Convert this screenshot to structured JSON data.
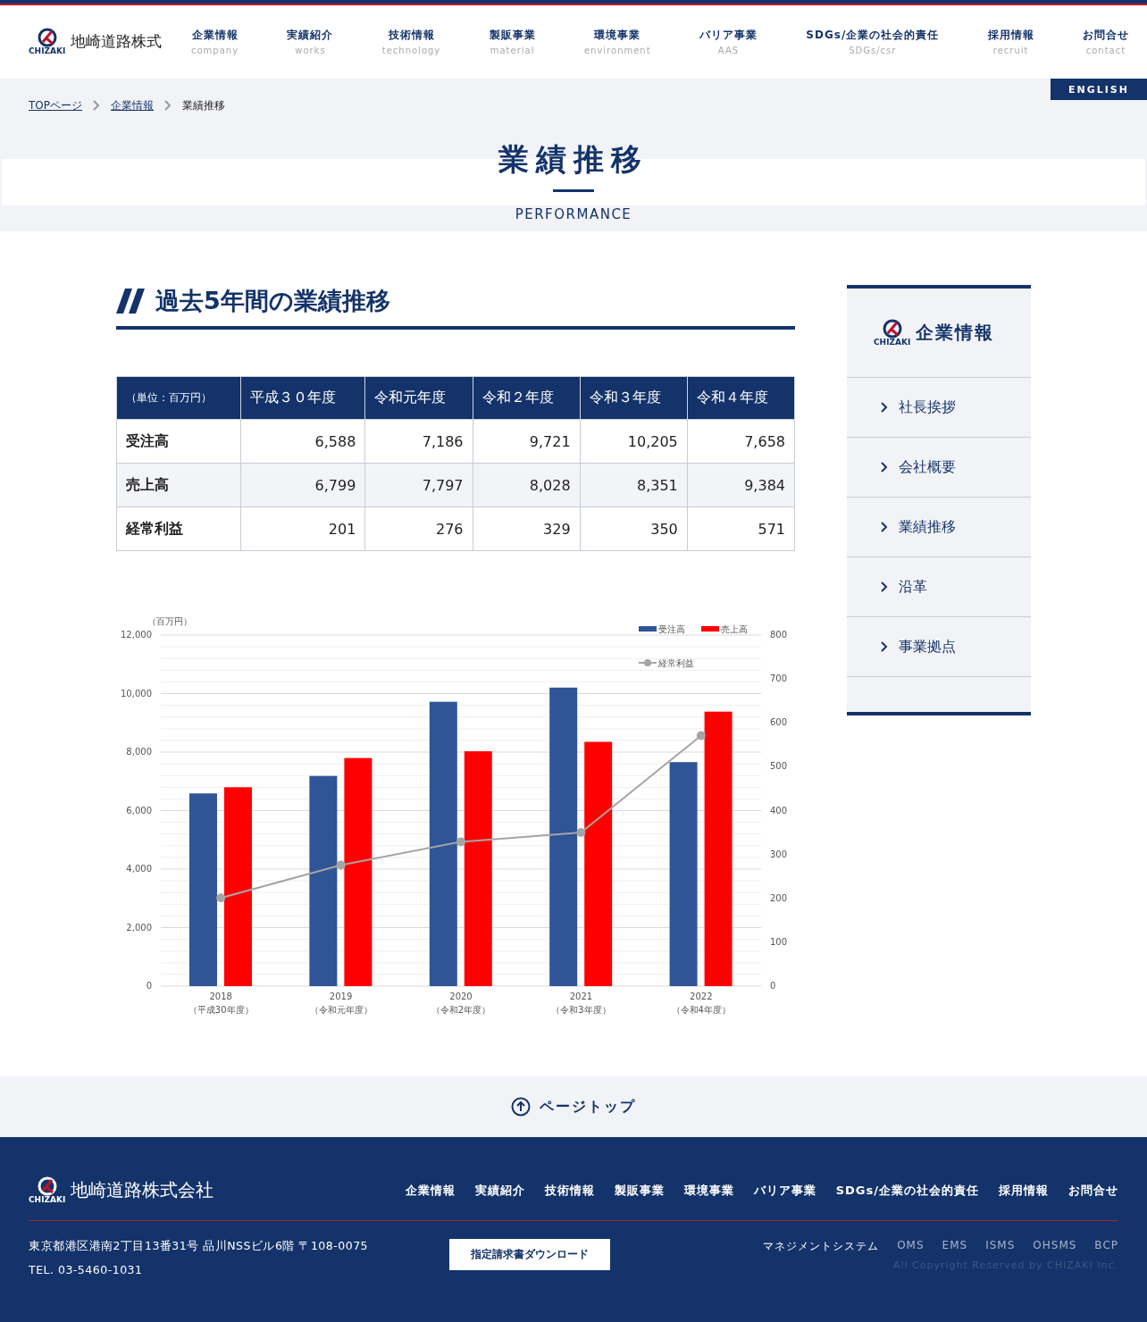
{
  "header": {
    "logo_mark": "CHIZAKI",
    "company": "地崎道路株式",
    "nav": [
      {
        "label": "企業情報",
        "sub": "company"
      },
      {
        "label": "実績紹介",
        "sub": "works"
      },
      {
        "label": "技術情報",
        "sub": "technology"
      },
      {
        "label": "製販事業",
        "sub": "material"
      },
      {
        "label": "環境事業",
        "sub": "environment"
      },
      {
        "label": "バリア事業",
        "sub": "AAS"
      },
      {
        "label": "SDGs/企業の社会的責任",
        "sub": "SDGs/csr"
      },
      {
        "label": "採用情報",
        "sub": "recruit"
      },
      {
        "label": "お問合せ",
        "sub": "contact"
      }
    ],
    "language_button": "ENGLISH"
  },
  "breadcrumb": [
    {
      "label": "TOPページ",
      "link": true
    },
    {
      "label": "企業情報",
      "link": true
    },
    {
      "label": "業績推移",
      "link": false
    }
  ],
  "page_title": "業績推移",
  "page_subtitle": "PERFORMANCE",
  "section_heading": "過去5年間の業績推移",
  "table": {
    "columns": [
      "（単位：百万円）",
      "平成３０年度",
      "令和元年度",
      "令和２年度",
      "令和３年度",
      "令和４年度"
    ],
    "rows": [
      [
        "受注高",
        "6,588",
        "7,186",
        "9,721",
        "10,205",
        "7,658"
      ],
      [
        "売上高",
        "6,799",
        "7,797",
        "8,028",
        "8,351",
        "9,384"
      ],
      [
        "経常利益",
        "201",
        "276",
        "329",
        "350",
        "571"
      ]
    ]
  },
  "chart": {
    "unit": "（百万円）",
    "category_notes": [
      "（平成30年度）",
      "（令和元年度）",
      "（令和2年度）",
      "（令和3年度）",
      "（令和4年度）"
    ],
    "chart_data": {
      "type": "bar",
      "categories": [
        "2018",
        "2019",
        "2020",
        "2021",
        "2022"
      ],
      "stacked": false,
      "grid": true,
      "legend": "upper right",
      "series": [
        {
          "name": "受注高",
          "color": "#2f5597",
          "values": [
            6588,
            7186,
            9721,
            10205,
            7658
          ]
        },
        {
          "name": "売上高",
          "color": "#ff0000",
          "values": [
            6799,
            7797,
            8028,
            8351,
            9384
          ]
        },
        {
          "name": "経常利益",
          "color": "#a5a5a5",
          "type": "line",
          "axis": "y2",
          "marker": "circle",
          "values": [
            201,
            276,
            329,
            350,
            571
          ]
        }
      ],
      "ylim": [
        0,
        12000
      ],
      "yticks": [
        {
          "value": 0,
          "label": "0"
        },
        {
          "value": 2000,
          "label": "2,000"
        },
        {
          "value": 4000,
          "label": "4,000"
        },
        {
          "value": 6000,
          "label": "6,000"
        },
        {
          "value": 8000,
          "label": "8,000"
        },
        {
          "value": 10000,
          "label": "10,000"
        },
        {
          "value": 12000,
          "label": "12,000"
        }
      ],
      "y2lim": [
        0,
        800
      ],
      "y2ticks": [
        0,
        100,
        200,
        300,
        400,
        500,
        600,
        700,
        800
      ]
    }
  },
  "sidebar": {
    "title": "企業情報",
    "logo_mark": "CHIZAKI",
    "items": [
      {
        "label": "社長挨拶",
        "selected": false
      },
      {
        "label": "会社概要",
        "selected": false
      },
      {
        "label": "業績推移",
        "selected": false
      },
      {
        "label": "沿革",
        "selected": false
      },
      {
        "label": "事業拠点",
        "selected": false
      }
    ]
  },
  "page_top": "ページトップ",
  "footer": {
    "logo_mark": "CHIZAKI",
    "company": "地崎道路株式会社",
    "nav": [
      "企業情報",
      "実績紹介",
      "技術情報",
      "製販事業",
      "環境事業",
      "バリア事業",
      "SDGs/企業の社会的責任",
      "採用情報",
      "お問合せ"
    ],
    "address": "東京都港区港南2丁目13番31号 品川NSSビル6階 〒108-0075",
    "tel": "TEL. 03-5460-1031",
    "download_button": "指定請求書ダウンロード",
    "links": [
      "マネジメントシステム",
      "OMS",
      "EMS",
      "ISMS",
      "OHSMS",
      "BCP"
    ],
    "copyright": "All Copyright Reserved by CHIZAKI Inc."
  }
}
